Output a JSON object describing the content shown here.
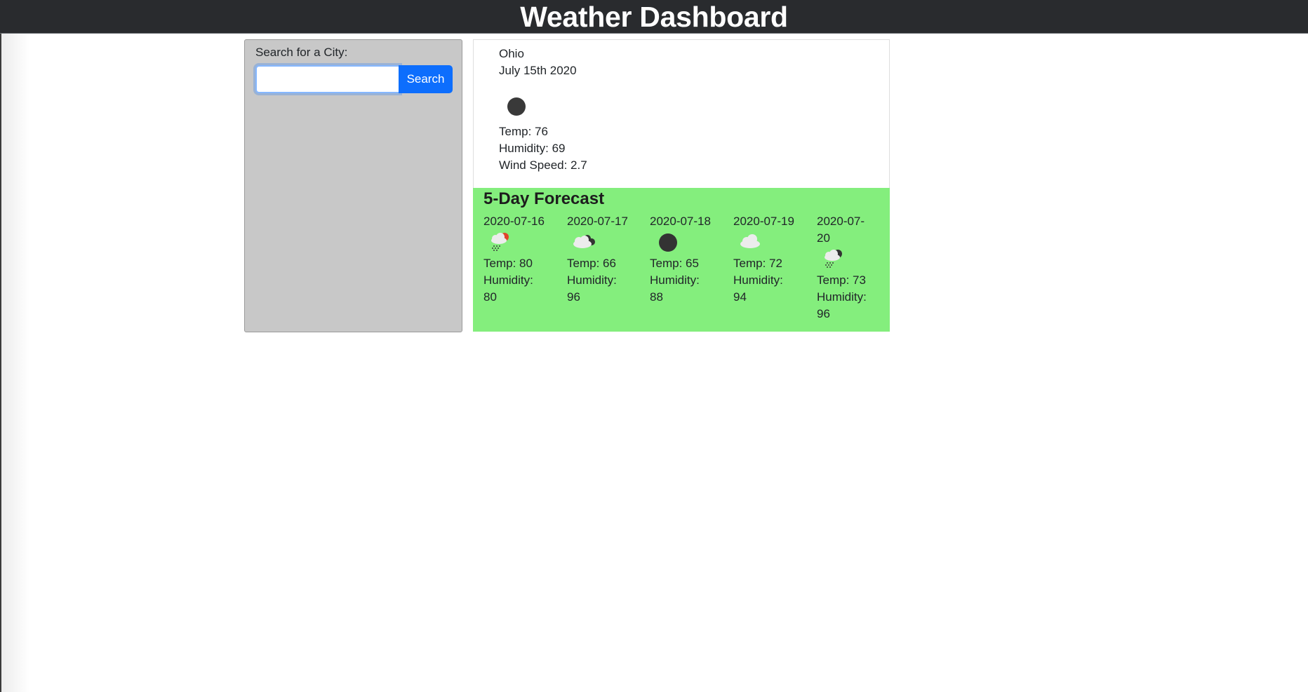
{
  "header": {
    "title": "Weather Dashboard"
  },
  "search": {
    "label": "Search for a City:",
    "input_value": "",
    "placeholder": "",
    "button_label": "Search"
  },
  "current": {
    "city": "Ohio",
    "date": "July 15th 2020",
    "icon": "moon-icon",
    "temp": "Temp: 76",
    "humidity": "Humidity: 69",
    "wind": "Wind Speed: 2.7"
  },
  "forecast": {
    "title": "5-Day Forecast",
    "days": [
      {
        "date": "2020-07-16",
        "icon": "rain-sun-icon",
        "temp": "Temp: 80",
        "humidity_label": "Humidity:",
        "humidity_value": "80"
      },
      {
        "date": "2020-07-17",
        "icon": "cloud-moon-icon",
        "temp": "Temp: 66",
        "humidity_label": "Humidity:",
        "humidity_value": "96"
      },
      {
        "date": "2020-07-18",
        "icon": "moon-icon",
        "temp": "Temp: 65",
        "humidity_label": "Humidity:",
        "humidity_value": "88"
      },
      {
        "date": "2020-07-19",
        "icon": "cloud-icon",
        "temp": "Temp: 72",
        "humidity_label": "Humidity:",
        "humidity_value": "94"
      },
      {
        "date_line1": "2020-07-",
        "date_line2": "20",
        "icon": "rain-moon-icon",
        "temp": "Temp: 73",
        "humidity_label": "Humidity:",
        "humidity_value": "96"
      }
    ]
  },
  "colors": {
    "header_bg": "#292b2e",
    "panel_bg": "#c8c8c8",
    "forecast_bg": "#84ee7d",
    "button_bg": "#0d6efd"
  }
}
